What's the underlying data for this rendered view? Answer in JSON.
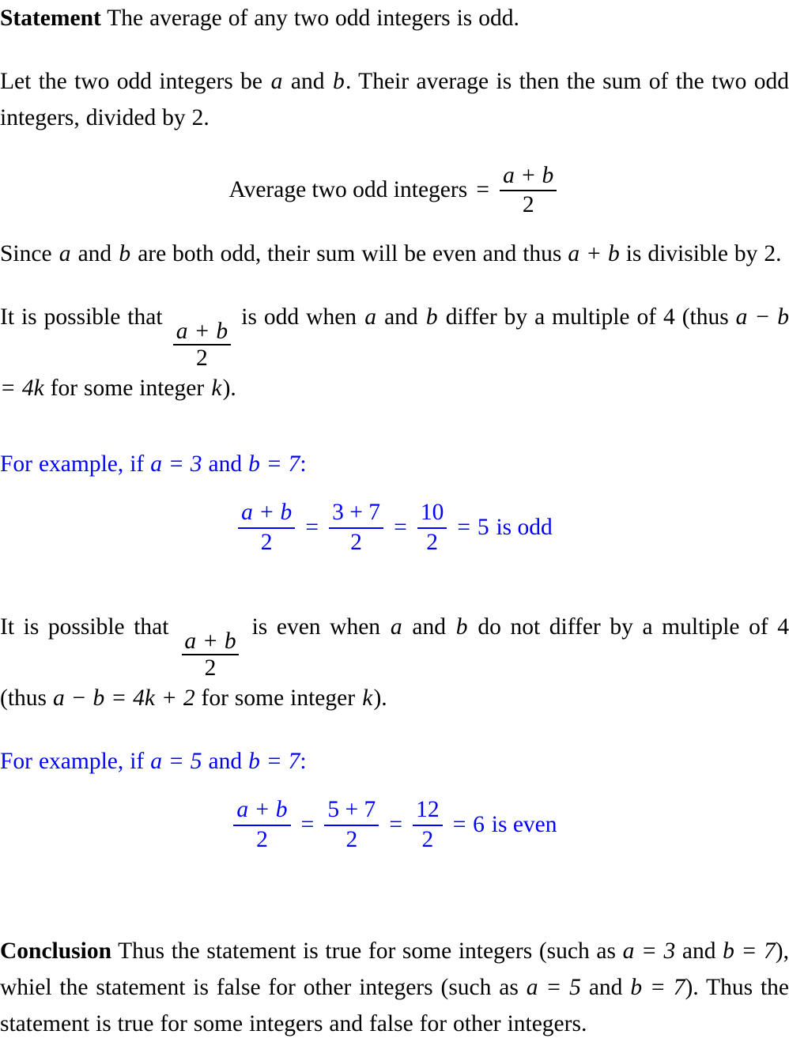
{
  "document": {
    "type": "mathematical-proof",
    "text_color": "#000000",
    "accent_color": "#0000ff"
  },
  "statement": {
    "heading": "Statement",
    "text": "The average of any two odd integers is odd."
  },
  "setup": {
    "part1": "Let the two odd integers be",
    "var_a": "a",
    "conj": "and",
    "var_b": "b",
    "part2": ". Their average is then the sum of the two odd integers, divided by 2."
  },
  "equation_definition": {
    "label": "Average two odd integers",
    "equals": "=",
    "numerator": "a + b",
    "denominator": "2"
  },
  "divisibility": {
    "part1": "Since",
    "var_a": "a",
    "conj": "and",
    "var_b": "b",
    "part2": "are both odd, their sum will be even and thus",
    "expr": "a + b",
    "part3": "is divisible by 2."
  },
  "case_odd": {
    "part1": "It is possible that",
    "frac_num": "a + b",
    "frac_den": "2",
    "part2": "is odd when",
    "var_a": "a",
    "conj": "and",
    "var_b": "b",
    "part3": "differ by a multiple of 4 (thus",
    "condition": "a − b = 4k",
    "part4": "for some integer",
    "var_k": "k",
    "part5": ")."
  },
  "example_odd": {
    "lead": "For example, if",
    "assign_a": "a = 3",
    "conj": "and",
    "assign_b": "b = 7",
    "colon": ":",
    "steps": [
      {
        "numerator": "a + b",
        "denominator": "2"
      },
      {
        "numerator": "3 + 7",
        "denominator": "2"
      },
      {
        "numerator": "10",
        "denominator": "2"
      }
    ],
    "equals": "=",
    "result": "5",
    "result_text": "is odd"
  },
  "case_even": {
    "part1": "It is possible that",
    "frac_num": "a + b",
    "frac_den": "2",
    "part2": "is even when",
    "var_a": "a",
    "conj": "and",
    "var_b": "b",
    "part3": "do not differ by a multiple of 4 (thus",
    "condition": "a − b = 4k + 2",
    "part4": "for some integer",
    "var_k": "k",
    "part5": ")."
  },
  "example_even": {
    "lead": "For example, if",
    "assign_a": "a = 5",
    "conj": "and",
    "assign_b": "b = 7",
    "colon": ":",
    "steps": [
      {
        "numerator": "a + b",
        "denominator": "2"
      },
      {
        "numerator": "5 + 7",
        "denominator": "2"
      },
      {
        "numerator": "12",
        "denominator": "2"
      }
    ],
    "equals": "=",
    "result": "6",
    "result_text": "is even"
  },
  "conclusion": {
    "heading": "Conclusion",
    "part1": "Thus the statement is true for some integers (such as",
    "assign_a1": "a = 3",
    "conj1": "and",
    "assign_b1": "b = 7",
    "part2": "), whiel the statement is false for other integers (such as",
    "assign_a2": "a = 5",
    "conj2": "and",
    "assign_b2": "b = 7",
    "part3": "). Thus the statement is true for some integers and false for other integers."
  }
}
